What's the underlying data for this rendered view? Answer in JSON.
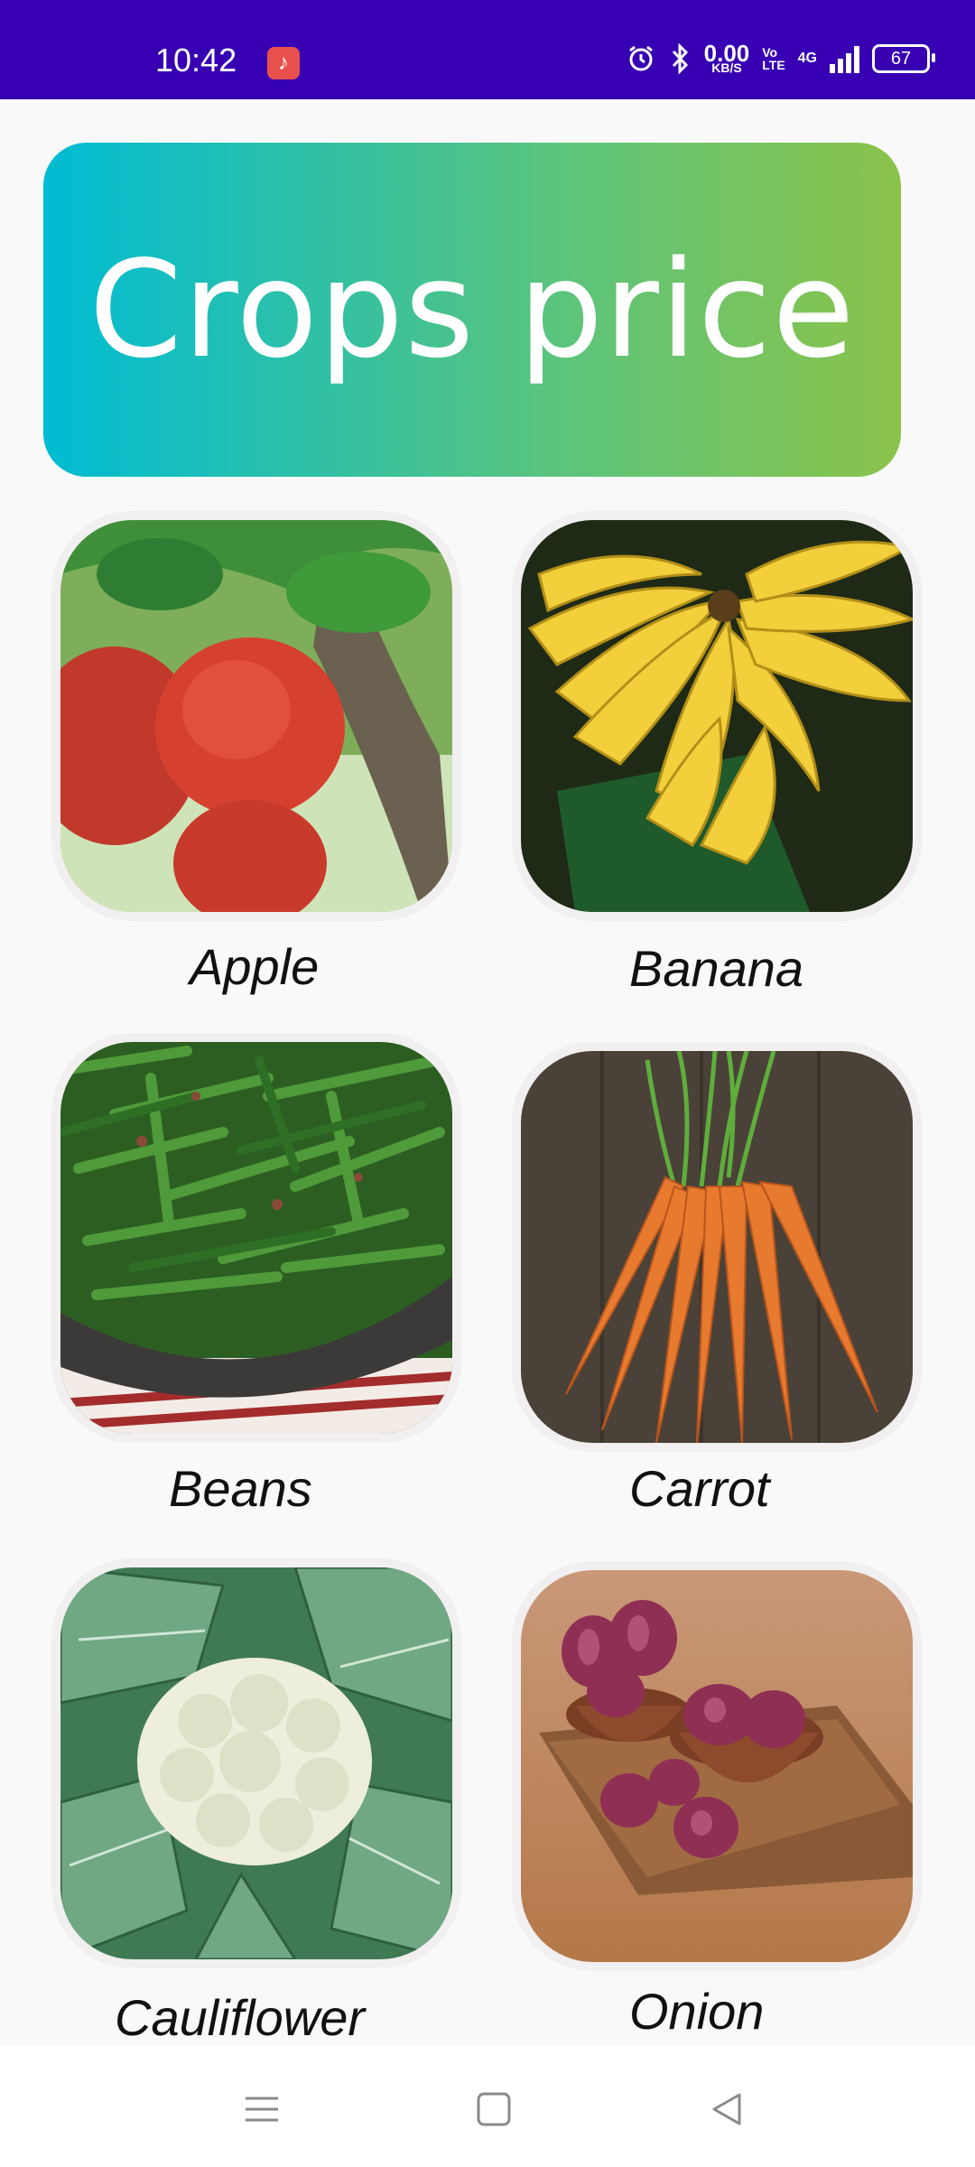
{
  "status_bar": {
    "time": "10:42",
    "net_speed_value": "0.00",
    "net_speed_unit": "KB/S",
    "volte_top": "Vo",
    "volte_bottom": "LTE",
    "network_type": "4G",
    "battery_level": "67",
    "colors": {
      "background": "#3700b3"
    }
  },
  "header": {
    "title": "Crops price",
    "gradient": [
      "#00bcd4",
      "#8bc34a"
    ]
  },
  "crops": [
    {
      "name": "Apple",
      "image_icon": "apple-icon"
    },
    {
      "name": "Banana",
      "image_icon": "banana-icon"
    },
    {
      "name": "Beans",
      "image_icon": "beans-icon"
    },
    {
      "name": "Carrot",
      "image_icon": "carrot-icon"
    },
    {
      "name": "Cauliflower",
      "image_icon": "cauliflower-icon"
    },
    {
      "name": "Onion",
      "image_icon": "onion-icon"
    }
  ],
  "nav_bar": {
    "icons": [
      "menu-icon",
      "home-square-icon",
      "back-triangle-icon"
    ]
  }
}
